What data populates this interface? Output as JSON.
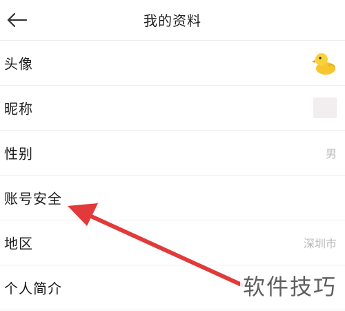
{
  "header": {
    "title": "我的资料",
    "back_icon": "arrow-left-icon"
  },
  "rows": [
    {
      "label": "头像",
      "value_type": "avatar",
      "icon": "duck-avatar-icon"
    },
    {
      "label": "昵称",
      "value_type": "thumbnail"
    },
    {
      "label": "性别",
      "value": "男"
    },
    {
      "label": "账号安全"
    },
    {
      "label": "地区",
      "value": "深圳市"
    },
    {
      "label": "个人简介"
    }
  ],
  "annotation": {
    "arrow_color": "#e23a3a"
  },
  "watermark": {
    "text": "软件技巧"
  },
  "colors": {
    "value_text": "#b7b7b7",
    "divider": "#eeeeee"
  }
}
